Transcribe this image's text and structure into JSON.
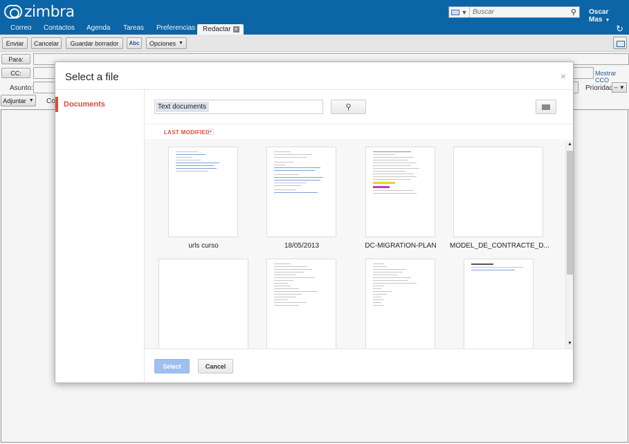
{
  "app": {
    "logo_text": "zimbra",
    "user_name": "Oscar Mas"
  },
  "search": {
    "placeholder": "Buscar"
  },
  "tabs": [
    {
      "label": "Correo"
    },
    {
      "label": "Contactos"
    },
    {
      "label": "Agenda"
    },
    {
      "label": "Tareas"
    },
    {
      "label": "Preferencias"
    },
    {
      "label": "Redactar"
    }
  ],
  "toolbar": {
    "send_label": "Enviar",
    "cancel_label": "Cancelar",
    "save_draft_label": "Guardar borrador",
    "spell_label": "Abc",
    "options_label": "Opciones"
  },
  "compose": {
    "to_label": "Para:",
    "cc_label": "CC:",
    "subject_label": "Asunto:",
    "attach_label": "Adjuntar",
    "attach_extra": "Co",
    "show_bcc_label": "Mostrar CCO",
    "priority_label": "Prioridad:",
    "priority_value": "--"
  },
  "dialog": {
    "title": "Select a file",
    "close_glyph": "×",
    "sidebar_item": "Documents",
    "filter_chip": "Text documents",
    "sort_label": "LAST MODIFIED",
    "select_label": "Select",
    "cancel_label": "Cancel",
    "files": [
      {
        "name": "urls curso"
      },
      {
        "name": "18/05/2013"
      },
      {
        "name": "DC-MIGRATION-PLAN"
      },
      {
        "name": "MODEL_DE_CONTRACTE_D..."
      },
      {
        "name": ""
      },
      {
        "name": ""
      },
      {
        "name": ""
      },
      {
        "name": ""
      }
    ]
  },
  "colors": {
    "brand_blue": "#0c6aad",
    "accent_red": "#dd4b39",
    "select_disabled": "#9fbff0"
  }
}
